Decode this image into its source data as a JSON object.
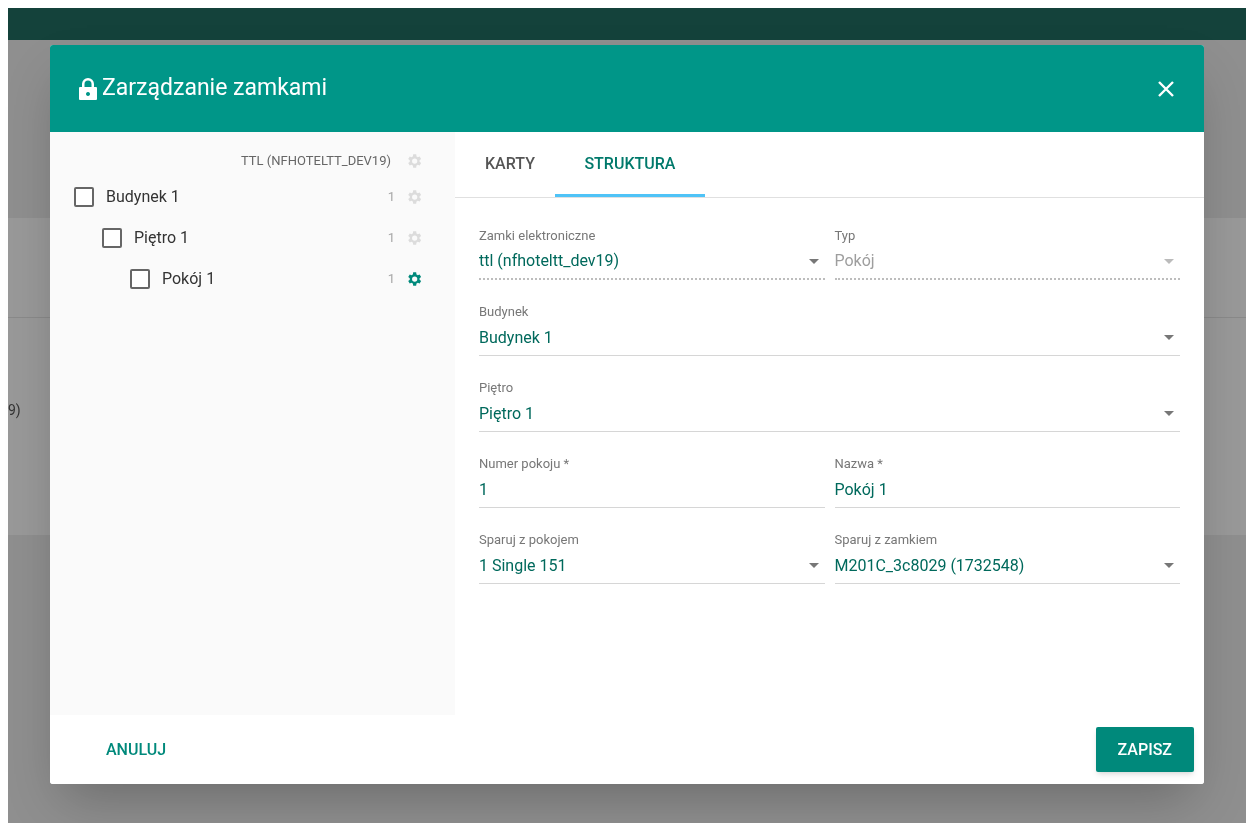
{
  "background": {
    "partial_text": "9)"
  },
  "dialog": {
    "title": "Zarządzanie zamkami",
    "tree": {
      "label": "TTL (NFHOTELTT_DEV19)",
      "gear_active": false,
      "children": [
        {
          "label": "Budynek 1",
          "count": "1",
          "checked": false,
          "gear_active": false,
          "children": [
            {
              "label": "Piętro 1",
              "count": "1",
              "checked": false,
              "gear_active": false,
              "children": [
                {
                  "label": "Pokój 1",
                  "count": "1",
                  "checked": false,
                  "gear_active": true
                }
              ]
            }
          ]
        }
      ]
    },
    "tabs": [
      {
        "label": "KARTY",
        "selected": false
      },
      {
        "label": "STRUKTURA",
        "selected": true
      }
    ],
    "form_rows": [
      [
        {
          "kind": "select",
          "label": "Zamki elektroniczne",
          "value": "ttl (nfhoteltt_dev19)",
          "readonly": true,
          "disabled": false
        },
        {
          "kind": "select",
          "label": "Typ",
          "value": "Pokój",
          "readonly": true,
          "disabled": true
        }
      ],
      [
        {
          "kind": "select",
          "label": "Budynek",
          "value": "Budynek 1",
          "readonly": false,
          "disabled": false
        }
      ],
      [
        {
          "kind": "select",
          "label": "Piętro",
          "value": "Piętro 1",
          "readonly": false,
          "disabled": false
        }
      ],
      [
        {
          "kind": "text",
          "label": "Numer pokoju *",
          "value": "1",
          "readonly": false,
          "disabled": false
        },
        {
          "kind": "text",
          "label": "Nazwa *",
          "value": "Pokój 1",
          "readonly": false,
          "disabled": false
        }
      ],
      [
        {
          "kind": "select",
          "label": "Sparuj z pokojem",
          "value": "1 Single 151",
          "readonly": false,
          "disabled": false
        },
        {
          "kind": "select",
          "label": "Sparuj z zamkiem",
          "value": "M201C_3c8029 (1732548)",
          "readonly": false,
          "disabled": false
        }
      ]
    ],
    "buttons": [
      {
        "label": "ANULUJ",
        "kind": "flat"
      },
      {
        "label": "ZAPISZ",
        "kind": "raised"
      }
    ]
  }
}
